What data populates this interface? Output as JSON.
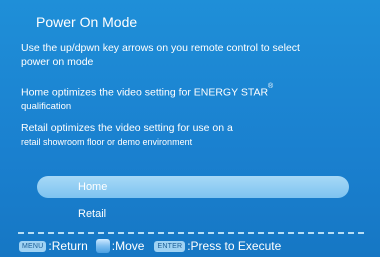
{
  "title": "Power On Mode",
  "instructions": {
    "line1": "Use the up/dpwn key arrows on you remote control to select",
    "line2": "power on mode",
    "home_desc_main": "Home optimizes the video setting for ENERGY STAR",
    "home_desc_mark": "®",
    "home_desc_line2": "qualification",
    "retail_desc_line1": "Retail optimizes the video setting for use on a",
    "retail_desc_line2": "retail showroom floor or demo environment"
  },
  "options": [
    {
      "label": "Home",
      "selected": true
    },
    {
      "label": "Retail",
      "selected": false
    }
  ],
  "footer": {
    "menu_key": "MENU",
    "menu_action": ":Return",
    "move_icon": "updown-arrow-key-icon",
    "move_action": ":Move",
    "enter_key": "ENTER",
    "enter_action": ":Press to Execute"
  }
}
